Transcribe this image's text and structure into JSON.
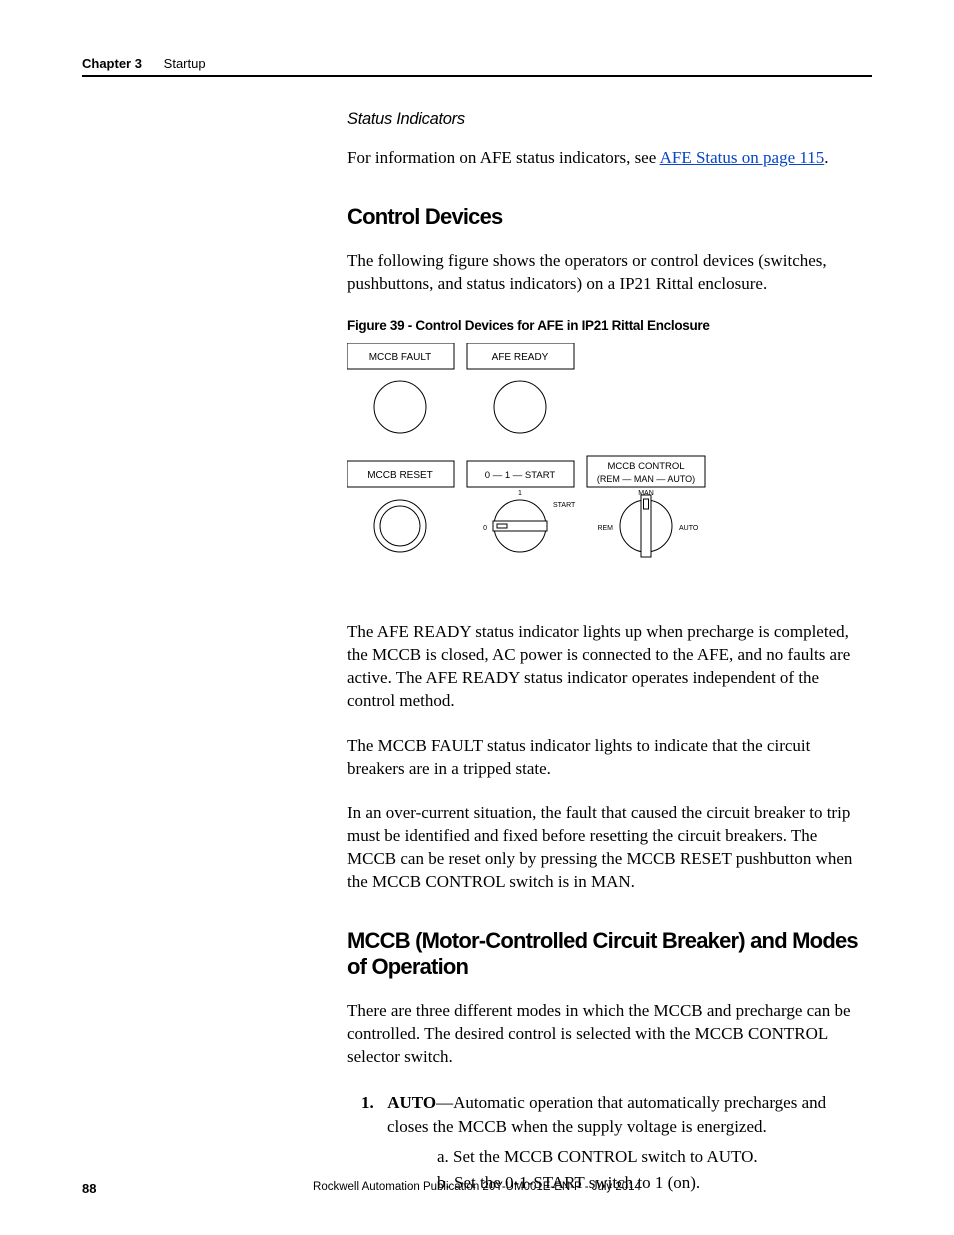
{
  "header": {
    "chapter": "Chapter 3",
    "title": "Startup"
  },
  "sec1": {
    "subhead": "Status Indicators",
    "p1_a": "For information on AFE status indicators, see ",
    "p1_link": "AFE Status on page 115",
    "p1_b": "."
  },
  "sec2": {
    "h": "Control Devices",
    "p1": "The following figure shows the operators or control devices (switches, pushbuttons, and status indicators) on a IP21 Rittal enclosure.",
    "figcap": "Figure 39 - Control Devices for AFE in IP21 Rittal Enclosure",
    "p2": "The AFE READY status indicator lights up when precharge is completed, the MCCB is closed, AC power is connected to the AFE, and no faults are active. The AFE READY status indicator operates independent of the control method.",
    "p3": "The MCCB FAULT status indicator lights to indicate that the circuit breakers are in a tripped state.",
    "p4": "In an over-current situation, the fault that caused the circuit breaker to trip must be identified and fixed before resetting the circuit breakers. The MCCB can be reset only by pressing the MCCB RESET pushbutton when the MCCB CONTROL switch is in MAN."
  },
  "fig": {
    "box1": "MCCB FAULT",
    "box2": "AFE READY",
    "box3": "MCCB RESET",
    "box4": "0  —  1  —  START",
    "box5a": "MCCB CONTROL",
    "box5b": "(REM — MAN — AUTO)",
    "l0": "0",
    "l1": "1",
    "lstart": "START",
    "lrem": "REM",
    "lman": "MAN",
    "lauto": "AUTO"
  },
  "sec3": {
    "h": "MCCB (Motor-Controlled Circuit Breaker) and Modes of Operation",
    "p1": "There are three different modes in which the MCCB and precharge can be controlled. The desired control is selected with the MCCB CONTROL selector switch.",
    "item1_num": "1.",
    "item1_term": "AUTO",
    "item1_rest": "—Automatic operation that automatically precharges and closes the MCCB when the supply voltage is energized.",
    "a": "a.   Set the MCCB CONTROL switch to AUTO.",
    "b": "b.   Set the 0-1-START switch to 1 (on)."
  },
  "footer": {
    "page": "88",
    "pub": "Rockwell Automation Publication 20Y-UM001E-EN-P - July 2014"
  }
}
